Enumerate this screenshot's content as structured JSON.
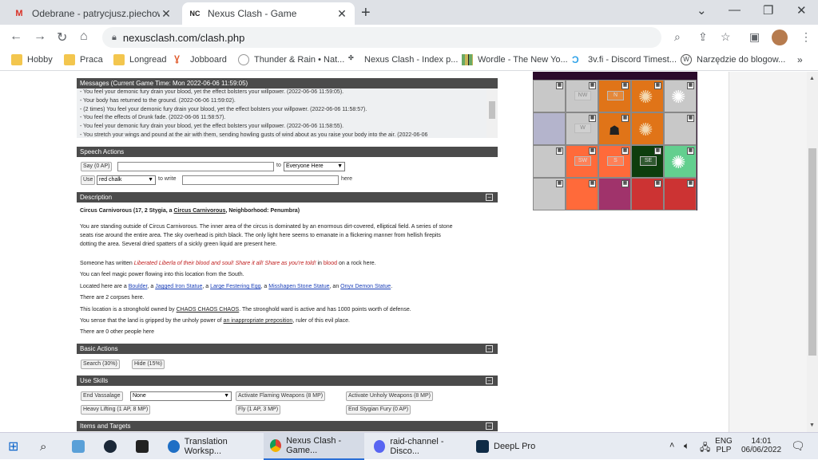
{
  "tabs": [
    {
      "label": "Odebrane - patrycjusz.piechowski@",
      "icon": "gmail-icon",
      "icon_glyph": "M",
      "icon_color": "#d93025"
    },
    {
      "label": "Nexus Clash - Game",
      "icon": "nexus-clash-icon",
      "icon_glyph": "NC",
      "icon_color": "#222222"
    }
  ],
  "toolbar": {
    "url": "nexusclash.com/clash.php"
  },
  "bookmarks": [
    {
      "label": "Hobby",
      "icon": "folder-icon"
    },
    {
      "label": "Praca",
      "icon": "folder-icon"
    },
    {
      "label": "Longread",
      "icon": "folder-icon"
    },
    {
      "label": "Jobboard",
      "icon": "jobboard-icon"
    },
    {
      "label": "Thunder & Rain • Nat...",
      "icon": "thunder-rain-icon"
    },
    {
      "label": "Nexus Clash - Index p...",
      "icon": "nexus-clash-icon"
    },
    {
      "label": "Wordle - The New Yo...",
      "icon": "wordle-icon"
    },
    {
      "label": "3v.fi - Discord Timest...",
      "icon": "3vfi-icon"
    },
    {
      "label": "Narzędzie do blogow...",
      "icon": "wordpress-icon"
    }
  ],
  "messages": {
    "header": "Messages (Current Game Time: Mon 2022-06-06 11:59:05)",
    "lines": [
      "- You feel your demonic fury drain your blood, yet the effect bolsters your willpower. (2022-06-06 11:59:05).",
      "- Your body has returned to the ground. (2022-06-06 11:59:02).",
      "- (2 times) You feel your demonic fury drain your blood, yet the effect bolsters your willpower. (2022-06-06 11:58:57).",
      "- You feel the effects of Drunk fade. (2022-06-06 11:58:57).",
      "- You feel your demonic fury drain your blood, yet the effect bolsters your willpower. (2022-06-06 11:58:55).",
      "- You stretch your wings and pound at the air with them, sending howling gusts of wind about as you raise your body into the air. (2022-06-06"
    ]
  },
  "speech": {
    "header": "Speech Actions",
    "say_button": "Say (0 AP)",
    "to_label": "to",
    "target_selected": "Everyone Here",
    "use_button": "Use",
    "item_selected": "red chalk",
    "to_write_label": "to write",
    "here_label": "here"
  },
  "description": {
    "header": "Description",
    "title": "Circus Carnivorous (17, 2 Stygia, a ",
    "title_link": "Circus Carnivorous",
    "title_tail": ", Neighborhood: Penumbra)",
    "para1": "You are standing outside of Circus Carnivorous. The inner area of the circus is dominated by an enormous dirt-covered, elliptical field. A series of stone",
    "para2": "seats rise around the entire area. The sky overhead is pitch black. The only light here seems to emanate in a flickering manner from hellish firepits",
    "para3": "dotting the area. Several dried spatters of a sickly green liquid are present here.",
    "graffiti_pre": "Someone has written ",
    "graffiti_text": "Liberated Liberla of their blood and soul! Share it all! Share as you're told!",
    "graffiti_mid": " in ",
    "graffiti_color": "blood",
    "graffiti_post": " on a rock here.",
    "magic": "You can feel magic power flowing into this location from the South.",
    "located_pre": "Located here are a ",
    "obj1": "Boulder",
    "obj2": "Jagged Iron Statue",
    "obj3": "Large Festering Egg",
    "obj4": "Misshapen Stone Statue",
    "obj5": "Onyx Demon Statue",
    "sep_a": ", a ",
    "sep_an": ", an ",
    "period": ".",
    "corpses": "There are 2 corpses here.",
    "stronghold_pre": "This location is a stronghold owned by ",
    "stronghold_owner": "CHAOS CHAOS CHAOS",
    "stronghold_post": ". The stronghold ward is active and has 1000 points worth of defense.",
    "land_pre": "You sense that the land is gripped by the unholy power of ",
    "land_link": "an inappropriate preposition",
    "land_post": ", ruler of this evil place.",
    "people": "There are 0 other people here"
  },
  "basic_actions": {
    "header": "Basic Actions",
    "search": "Search (30%)",
    "hide": "Hide (15%)"
  },
  "use_skills": {
    "header": "Use Skills",
    "end_vassalage": "End Vassalage",
    "vassal_selected": "None",
    "flaming": "Activate Flaming Weapons (8 MP)",
    "unholy": "Activate Unholy Weapons (8 MP)",
    "heavy_lifting": "Heavy Lifting (1 AP, 8 MP)",
    "fly": "Fly (1 AP, 3 MP)",
    "end_fury": "End Stygian Fury (0 AP)"
  },
  "items": {
    "header": "Items and Targets"
  },
  "map": {
    "labels": {
      "nw": "NW",
      "n": "N",
      "w": "W",
      "sw": "SW",
      "s": "S",
      "se": "SE"
    },
    "colors": {
      "grey": "#c8c8c8",
      "lavender": "#b4b4cc",
      "orange": "#e07418",
      "brightorange": "#ff6a3a",
      "darkgreen": "#0d3d0d",
      "mint": "#63cf8f",
      "magenta": "#a0336b",
      "red": "#cc3333"
    }
  },
  "taskbar": {
    "apps": [
      {
        "label": "Translation Worksp...",
        "icon": "x-translate-icon"
      },
      {
        "label": "Nexus Clash - Game...",
        "icon": "chrome-icon"
      },
      {
        "label": "raid-channel - Disco...",
        "icon": "discord-icon"
      },
      {
        "label": "DeepL Pro",
        "icon": "deepl-icon"
      }
    ],
    "lang_top": "ENG",
    "lang_bottom": "PLP",
    "time": "14:01",
    "date": "06/06/2022"
  }
}
